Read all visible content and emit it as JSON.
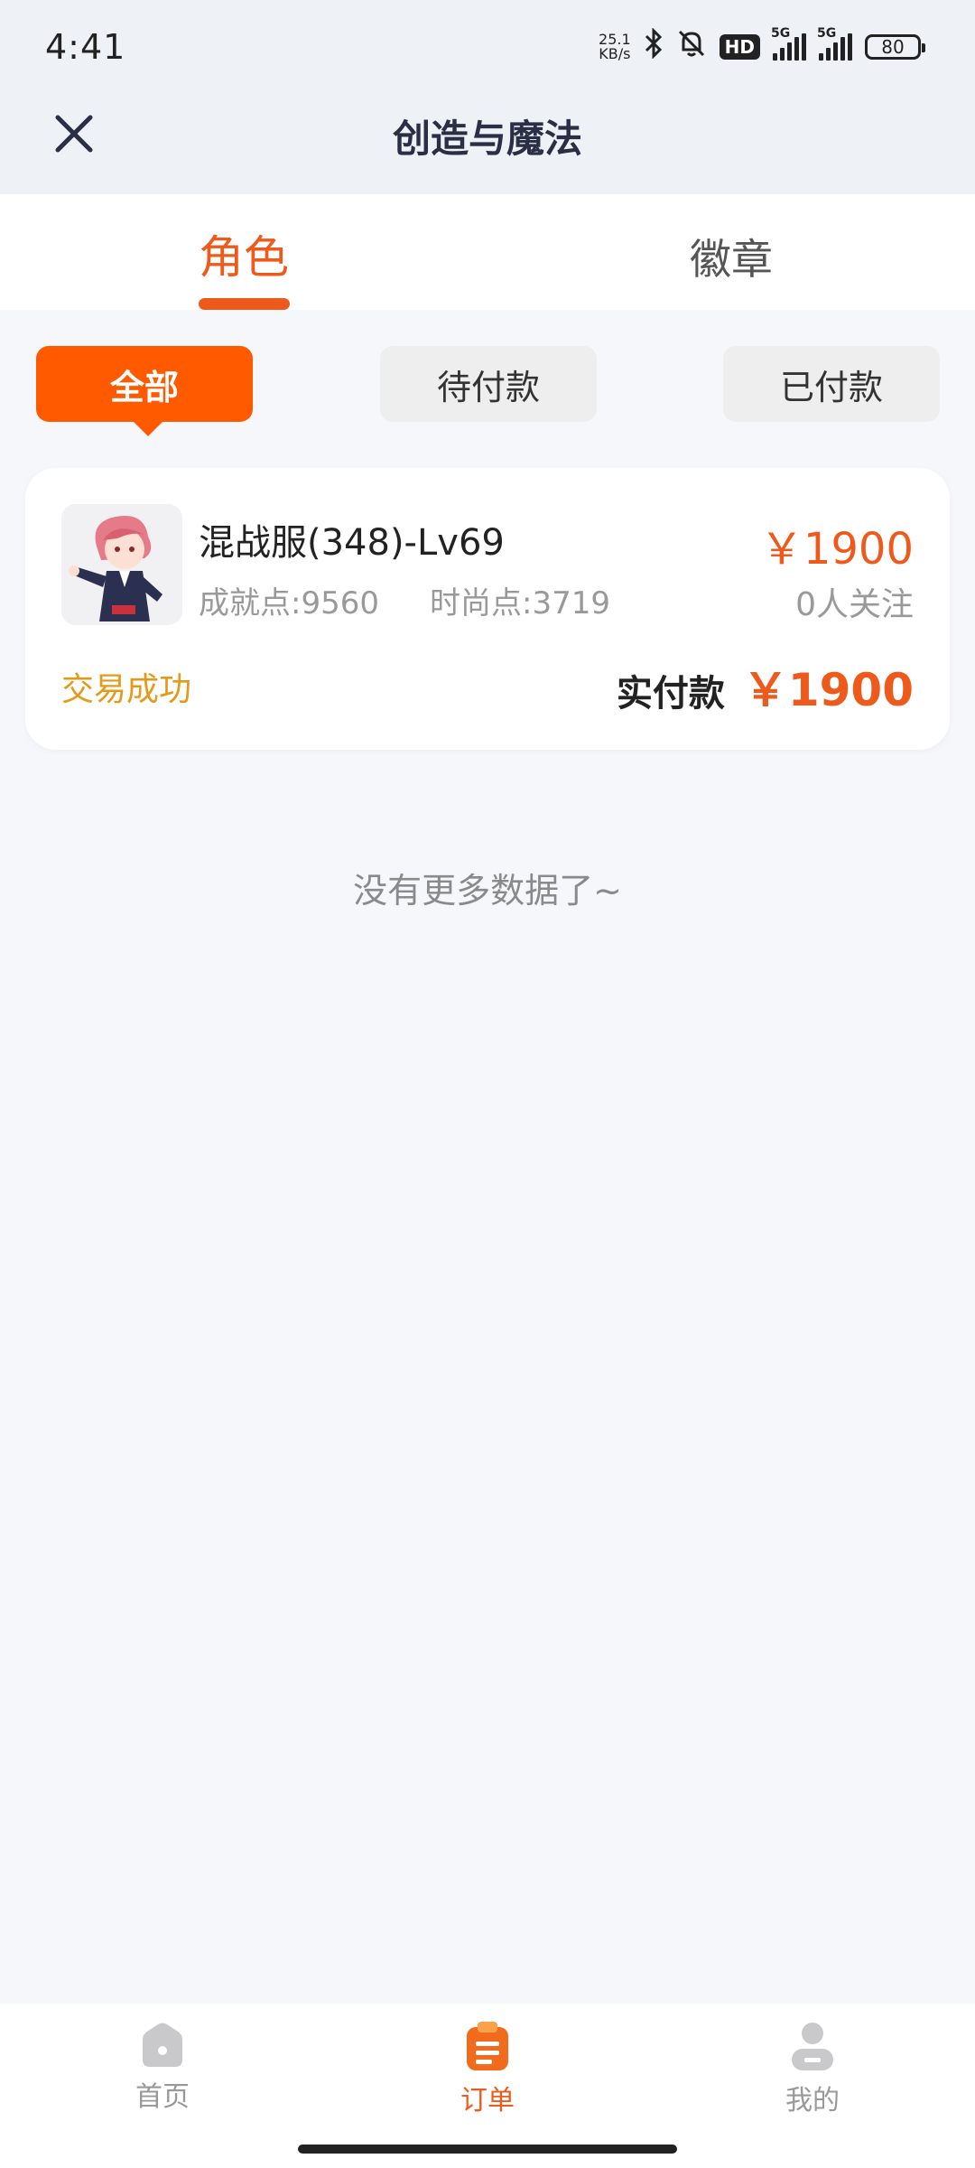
{
  "status_bar": {
    "time": "4:41",
    "speed_value": "25.1",
    "speed_unit": "KB/s",
    "hd_label": "HD",
    "net1": "5G",
    "net2": "5G",
    "battery": "80"
  },
  "header": {
    "title": "创造与魔法"
  },
  "tabs": [
    {
      "label": "角色",
      "active": true
    },
    {
      "label": "徽章",
      "active": false
    }
  ],
  "filters": [
    {
      "label": "全部",
      "active": true
    },
    {
      "label": "待付款",
      "active": false
    },
    {
      "label": "已付款",
      "active": false
    }
  ],
  "order": {
    "name": "混战服(348)-Lv69",
    "achievement": "成就点:9560",
    "fashion": "时尚点:3719",
    "price": "￥1900",
    "followers": "0人关注",
    "status": "交易成功",
    "paid_label": "实付款",
    "paid_value": "￥1900"
  },
  "empty_text": "没有更多数据了~",
  "bottom_nav": [
    {
      "label": "首页",
      "icon": "home-icon",
      "active": false
    },
    {
      "label": "订单",
      "icon": "order-icon",
      "active": true
    },
    {
      "label": "我的",
      "icon": "profile-icon",
      "active": false
    }
  ],
  "colors": {
    "accent": "#ee5a1c",
    "filter_active": "#ff5a00",
    "status_success": "#e39a19",
    "background": "#f5f7fa"
  }
}
